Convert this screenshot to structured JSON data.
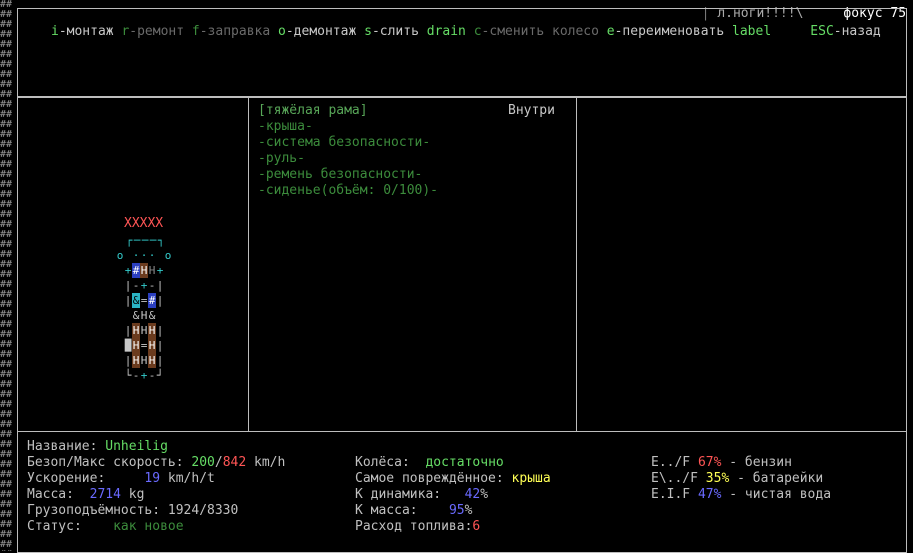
{
  "top_fragment": {
    "left": "л.ноги!!!!\\",
    "right": "фокус 75"
  },
  "hotkeys": [
    {
      "key": "i",
      "label": "-монтаж",
      "enabled": true
    },
    {
      "key": "r",
      "label": "-ремонт",
      "enabled": false
    },
    {
      "key": "f",
      "label": "-заправка",
      "enabled": false
    },
    {
      "key": "o",
      "label": "-демонтаж",
      "enabled": true
    },
    {
      "key": "s",
      "label": "-слить",
      "enabled": true
    },
    {
      "key": "drain",
      "label": "",
      "enabled": true
    },
    {
      "key": "c",
      "label": "-сменить колесо",
      "enabled": false
    },
    {
      "key": "e",
      "label": "-переименовать",
      "enabled": true
    },
    {
      "key": "label",
      "label": "",
      "enabled": true
    },
    {
      "key": "ESC",
      "label": "-назад",
      "enabled": true
    }
  ],
  "parts": {
    "header": "[тяжёлая рама]",
    "location": "Внутри",
    "items": [
      "-крыша-",
      "-система безопасности-",
      "-руль-",
      "-ремень безопасности-",
      "-сиденье(объём: 0/100)-"
    ]
  },
  "vehicle_map": {
    "marker": "XXXXX",
    "rows": [
      [
        {
          "ch": "┌",
          "c": "c"
        },
        {
          "ch": "─",
          "c": "c"
        },
        {
          "ch": "─",
          "c": "c"
        },
        {
          "ch": "─",
          "c": "c"
        },
        {
          "ch": "┐",
          "c": "c"
        }
      ],
      [
        {
          "ch": "o",
          "c": "c"
        },
        {
          "ch": " ",
          "c": ""
        },
        {
          "ch": "·",
          "c": "c"
        },
        {
          "ch": "·",
          "c": "c"
        },
        {
          "ch": "·",
          "c": "c"
        },
        {
          "ch": " ",
          "c": ""
        },
        {
          "ch": "o",
          "c": "c"
        }
      ],
      [
        {
          "ch": "+",
          "c": "c"
        },
        {
          "ch": "#",
          "c": "bg-blue"
        },
        {
          "ch": "H",
          "c": "bg-brown"
        },
        {
          "ch": "H",
          "c": "gr"
        },
        {
          "ch": "+",
          "c": "c"
        }
      ],
      [
        {
          "ch": "|",
          "c": "w"
        },
        {
          "ch": "-",
          "c": "w"
        },
        {
          "ch": "+",
          "c": "c"
        },
        {
          "ch": "-",
          "c": "w"
        },
        {
          "ch": "|",
          "c": "w"
        }
      ],
      [
        {
          "ch": "|",
          "c": "w"
        },
        {
          "ch": "&",
          "c": "bg-cyan"
        },
        {
          "ch": "=",
          "c": "w"
        },
        {
          "ch": "#",
          "c": "bg-blue"
        },
        {
          "ch": "|",
          "c": "w"
        }
      ],
      [
        {
          "ch": " ",
          "c": ""
        },
        {
          "ch": "&",
          "c": "w"
        },
        {
          "ch": "H",
          "c": "w"
        },
        {
          "ch": "&",
          "c": "w"
        },
        {
          "ch": " ",
          "c": ""
        }
      ],
      [
        {
          "ch": "|",
          "c": "w"
        },
        {
          "ch": "H",
          "c": "bg-brown"
        },
        {
          "ch": "H",
          "c": "w"
        },
        {
          "ch": "H",
          "c": "bg-brown"
        },
        {
          "ch": "|",
          "c": "w"
        }
      ],
      [
        {
          "ch": "█",
          "c": "w"
        },
        {
          "ch": "H",
          "c": "bg-brown"
        },
        {
          "ch": "=",
          "c": "w"
        },
        {
          "ch": "H",
          "c": "bg-brown"
        },
        {
          "ch": "|",
          "c": "w"
        }
      ],
      [
        {
          "ch": "|",
          "c": "w"
        },
        {
          "ch": "H",
          "c": "bg-brown"
        },
        {
          "ch": "H",
          "c": "w"
        },
        {
          "ch": "H",
          "c": "bg-brown"
        },
        {
          "ch": "|",
          "c": "w"
        }
      ],
      [
        {
          "ch": "└",
          "c": "w"
        },
        {
          "ch": "-",
          "c": "w"
        },
        {
          "ch": "+",
          "c": "c"
        },
        {
          "ch": "-",
          "c": "w"
        },
        {
          "ch": "┘",
          "c": "w"
        }
      ]
    ]
  },
  "stats": {
    "name_label": "Название:",
    "name_value": "Unheilig",
    "speed_label": "Безоп/Макс скорость:",
    "safe_speed": "200",
    "slash": "/",
    "max_speed": "842",
    "speed_unit": "km/h",
    "accel_label": "Ускорение:",
    "accel_value": "19",
    "accel_unit": "km/h/t",
    "mass_label": "Масса:",
    "mass_value": "2714",
    "mass_unit": "kg",
    "cargo_label": "Грузоподъёмность:",
    "cargo_value": "1924/8330",
    "status_label": "Статус:",
    "status_value": "как новое",
    "wheels_label": "Колёса:",
    "wheels_value": "достаточно",
    "damaged_label": "Самое повреждённое:",
    "damaged_value": "крыша",
    "dyn_label": "К динамика:",
    "dyn_value": "42",
    "dyn_pct": "%",
    "kmass_label": "К масса:",
    "kmass_value": "95",
    "kmass_pct": "%",
    "fuel_use_label": "Расход топлива:",
    "fuel_use_value": "6"
  },
  "tanks": [
    {
      "gauge": "E../F",
      "pct": "67%",
      "name": " - бензин",
      "pct_color": "#ff5555"
    },
    {
      "gauge": "E\\../F",
      "pct": "35%",
      "name": " - батарейки",
      "pct_color": "#ffff55"
    },
    {
      "gauge": "E.I.F",
      "pct": "47%",
      "name": " - чистая вода",
      "pct_color": "#6a6aff"
    }
  ]
}
